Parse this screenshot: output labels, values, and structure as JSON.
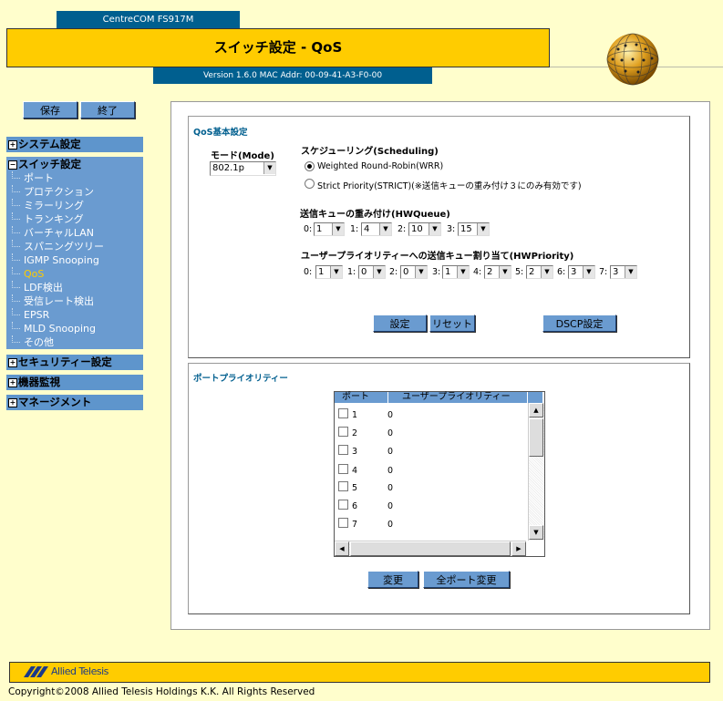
{
  "header": {
    "model": "CentreCOM FS917M",
    "title": "スイッチ設定 - QoS",
    "version": "Version 1.6.0 MAC Addr: 00-09-41-A3-F0-00"
  },
  "top_buttons": {
    "save": "保存",
    "exit": "終了"
  },
  "sidebar": {
    "system": "システム設定",
    "switch": "スイッチ設定",
    "switch_items": [
      "ポート",
      "プロテクション",
      "ミラーリング",
      "トランキング",
      "バーチャルLAN",
      "スパニングツリー",
      "IGMP Snooping",
      "QoS",
      "LDF検出",
      "受信レート検出",
      "EPSR",
      "MLD Snooping",
      "その他"
    ],
    "active_item": "QoS",
    "security": "セキュリティー設定",
    "monitor": "機器監視",
    "management": "マネージメント",
    "colors": {
      "section": "#5e95cc",
      "active": "#ffcc00"
    }
  },
  "qos": {
    "legend": "QoS基本設定",
    "mode_label": "モード(Mode)",
    "mode_value": "802.1p",
    "sched_label": "スケジューリング(Scheduling)",
    "sched_wrr": "Weighted Round-Robin(WRR)",
    "sched_strict": "Strict Priority(STRICT)(※送信キューの重み付け３にのみ有効です)",
    "sched_selected": "WRR",
    "hwqueue_label": "送信キューの重み付け(HWQueue)",
    "hwqueue": [
      {
        "q": "0:",
        "v": "1"
      },
      {
        "q": "1:",
        "v": "4"
      },
      {
        "q": "2:",
        "v": "10"
      },
      {
        "q": "3:",
        "v": "15"
      }
    ],
    "hwpriority_label": "ユーザープライオリティーへの送信キュー割り当て(HWPriority)",
    "hwpriority": [
      {
        "p": "0:",
        "v": "1"
      },
      {
        "p": "1:",
        "v": "0"
      },
      {
        "p": "2:",
        "v": "0"
      },
      {
        "p": "3:",
        "v": "1"
      },
      {
        "p": "4:",
        "v": "2"
      },
      {
        "p": "5:",
        "v": "2"
      },
      {
        "p": "6:",
        "v": "3"
      },
      {
        "p": "7:",
        "v": "3"
      }
    ],
    "btn_set": "設定",
    "btn_reset": "リセット",
    "btn_dscp": "DSCP設定"
  },
  "port_priority": {
    "legend": "ポートプライオリティー",
    "col_port": "ポート",
    "col_user_priority": "ユーザープライオリティー",
    "rows": [
      {
        "port": "1",
        "prio": "0"
      },
      {
        "port": "2",
        "prio": "0"
      },
      {
        "port": "3",
        "prio": "0"
      },
      {
        "port": "4",
        "prio": "0"
      },
      {
        "port": "5",
        "prio": "0"
      },
      {
        "port": "6",
        "prio": "0"
      },
      {
        "port": "7",
        "prio": "0"
      }
    ],
    "btn_change": "変更",
    "btn_change_all": "全ポート変更"
  },
  "footer": {
    "logo": "Allied Telesis",
    "copyright": "Copyright©2008 Allied Telesis Holdings K.K. All Rights Reserved"
  }
}
